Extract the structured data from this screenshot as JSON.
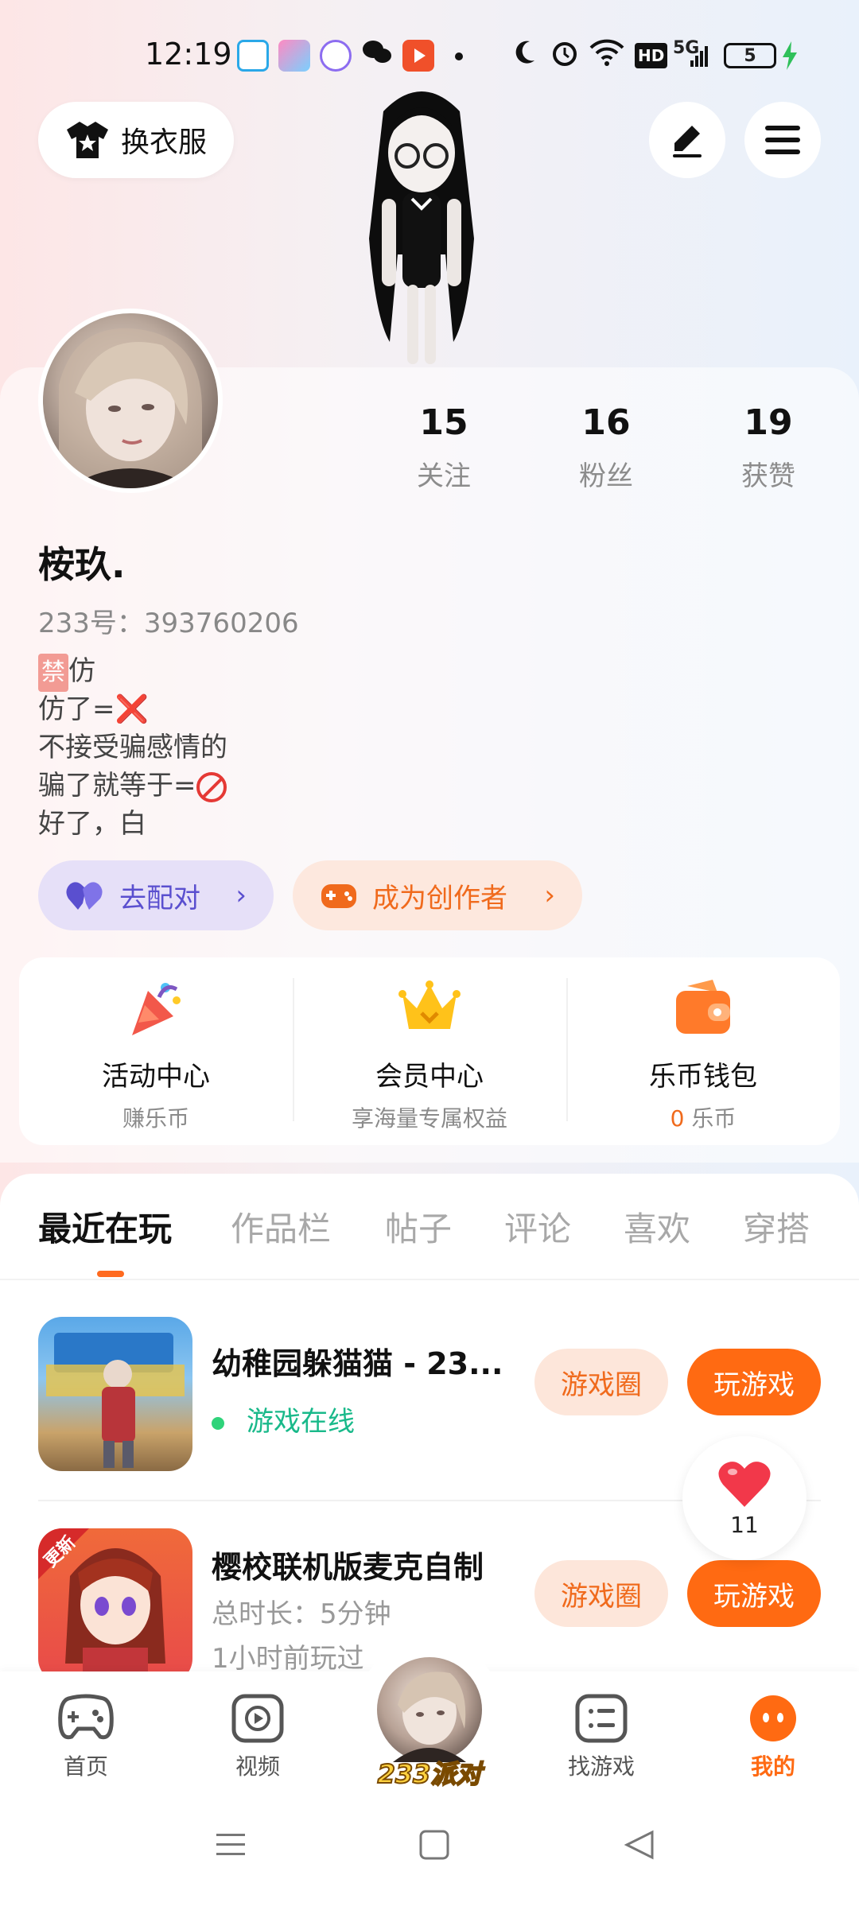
{
  "status_bar": {
    "time": "12:19",
    "battery": "5",
    "network": "5G",
    "hd": "HD"
  },
  "header": {
    "change_clothes_label": "换衣服"
  },
  "profile": {
    "stats": [
      {
        "value": "15",
        "label": "关注"
      },
      {
        "value": "16",
        "label": "粉丝"
      },
      {
        "value": "19",
        "label": "获赞"
      }
    ],
    "username": "桉玖.",
    "uid_label": "233号：",
    "uid_value": "393760206",
    "bio": {
      "ban_mark": "禁",
      "line1_text": "仿",
      "line2_text": "仿了=",
      "line2_mark": "❌",
      "line3_text": "不接受骗感情的",
      "line4_text": "骗了就等于=",
      "line5_text": "好了，白"
    },
    "match_label": "去配对",
    "creator_label": "成为创作者"
  },
  "features": [
    {
      "title": "活动中心",
      "subtitle": "赚乐币"
    },
    {
      "title": "会员中心",
      "subtitle": "享海量专属权益"
    },
    {
      "title": "乐币钱包",
      "coin_value": "0",
      "subtitle": "乐币"
    }
  ],
  "tabs": [
    "最近在玩",
    "作品栏",
    "帖子",
    "评论",
    "喜欢",
    "穿搭"
  ],
  "games": [
    {
      "title": "幼稚园躲猫猫 - 23...",
      "status": "游戏在线",
      "circle_label": "游戏圈",
      "play_label": "玩游戏"
    },
    {
      "title": "樱校联机版麦克自制",
      "duration": "总时长：5分钟",
      "last_played": "1小时前玩过",
      "badge": "更新",
      "circle_label": "游戏圈",
      "play_label": "玩游戏"
    }
  ],
  "like_float": {
    "count": "11"
  },
  "bottom_nav": {
    "items": [
      "首页",
      "视频",
      "找游戏",
      "我的"
    ],
    "center_label": "233派对"
  },
  "colors": {
    "accent": "#ff6a12",
    "match": "#5a4fcf",
    "online": "#19b98a"
  }
}
